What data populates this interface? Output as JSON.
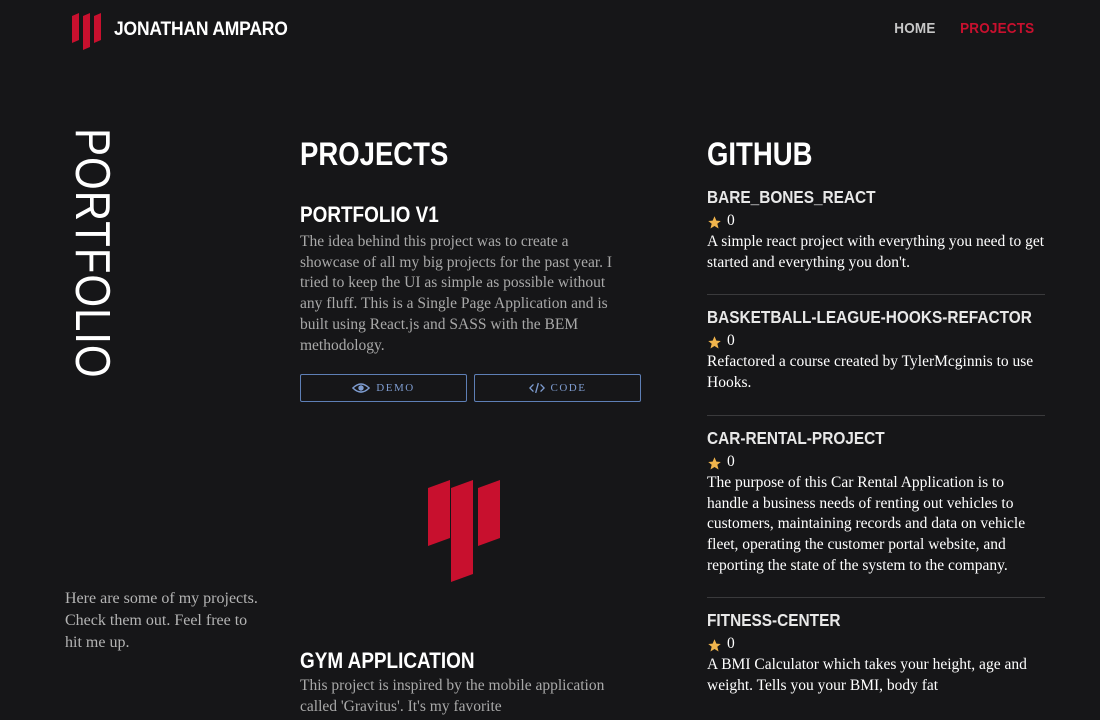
{
  "header": {
    "brand_name": "JONATHAN AMPARO",
    "nav": {
      "home": "HOME",
      "projects": "PROJECTS"
    }
  },
  "sidebar": {
    "title": "PORTFOLIO",
    "intro": "Here are some of my projects. Check them out. Feel free to hit me up."
  },
  "projects": {
    "heading": "PROJECTS",
    "items": [
      {
        "title": "PORTFOLIO V1",
        "description": "The idea behind this project was to create a showcase of all my big projects for the past year. I tried to keep the UI as simple as possible without any fluff. This is a Single Page Application and is built using React.js and SASS with the BEM methodology.",
        "demo_label": "DEMO",
        "code_label": "CODE"
      },
      {
        "title": "GYM APPLICATION",
        "description": "This project is inspired by the mobile application called 'Gravitus'. It's my favorite"
      }
    ]
  },
  "github": {
    "heading": "GITHUB",
    "repos": [
      {
        "name": "BARE_BONES_REACT",
        "stars": "0",
        "description": "A simple react project with everything you need to get started and everything you don't."
      },
      {
        "name": "BASKETBALL-LEAGUE-HOOKS-REFACTOR",
        "stars": "0",
        "description": "Refactored a course created by TylerMcginnis to use Hooks."
      },
      {
        "name": "CAR-RENTAL-PROJECT",
        "stars": "0",
        "description": "The purpose of this Car Rental Application is to handle a business needs of renting out vehicles to customers, maintaining records and data on vehicle fleet, operating the customer portal website, and reporting the state of the system to the company."
      },
      {
        "name": "FITNESS-CENTER",
        "stars": "0",
        "description": "A BMI Calculator which takes your height, age and weight. Tells you your BMI, body fat"
      }
    ]
  },
  "icons": {
    "logo": "jm-logo-icon",
    "demo": "eye-icon",
    "code": "code-icon",
    "star": "star-icon"
  },
  "colors": {
    "background": "#161618",
    "accent": "#c8102e",
    "button_border": "#5e7fb6",
    "star": "#f0b44c"
  }
}
